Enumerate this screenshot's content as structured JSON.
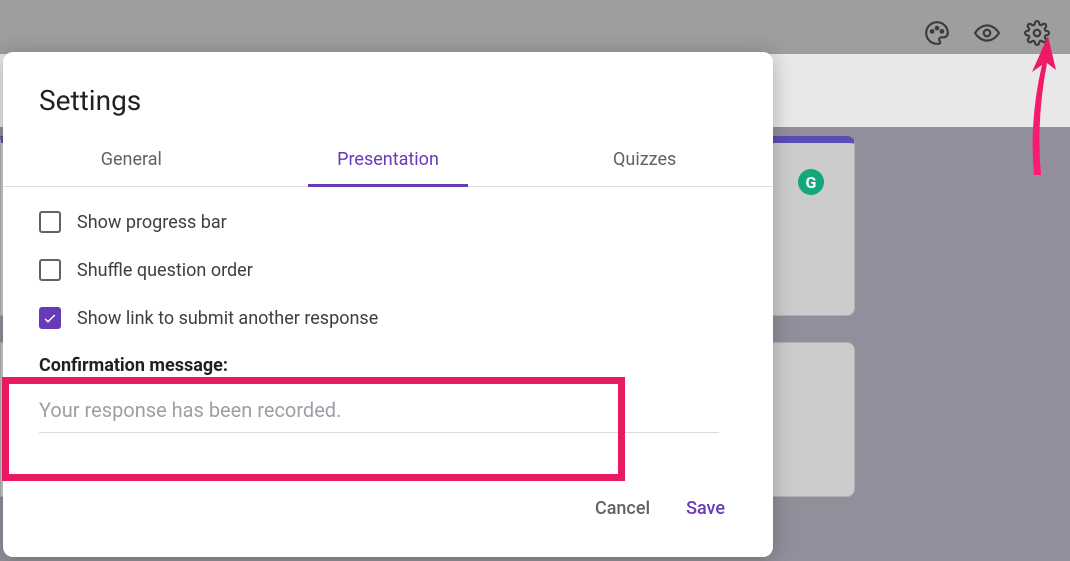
{
  "dialog": {
    "title": "Settings",
    "tabs": {
      "general": "General",
      "presentation": "Presentation",
      "quizzes": "Quizzes",
      "active": "presentation"
    },
    "options": {
      "progress_bar": {
        "label": "Show progress bar",
        "checked": false
      },
      "shuffle": {
        "label": "Shuffle question order",
        "checked": false
      },
      "submit_another": {
        "label": "Show link to submit another response",
        "checked": true
      }
    },
    "confirmation": {
      "label": "Confirmation message:",
      "placeholder": "Your response has been recorded.",
      "value": ""
    },
    "buttons": {
      "cancel": "Cancel",
      "save": "Save"
    }
  },
  "background": {
    "grammarly_glyph": "G"
  },
  "icons": {
    "palette": "palette-icon",
    "preview": "eye-icon",
    "settings": "gear-icon"
  },
  "colors": {
    "accent": "#673ab7",
    "highlight": "#e91a63"
  }
}
